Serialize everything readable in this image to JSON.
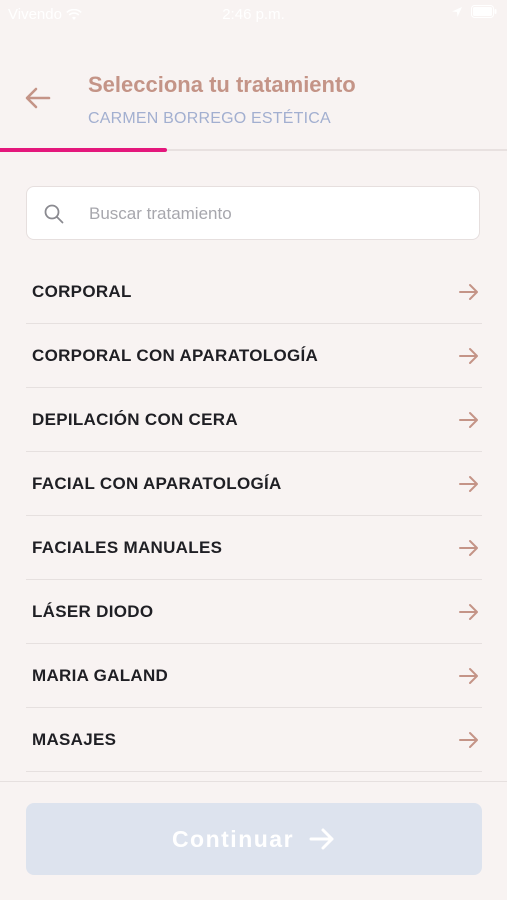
{
  "status_bar": {
    "carrier": "Vivendo",
    "time": "2:46 p.m."
  },
  "header": {
    "back_icon": "arrow-left-icon",
    "title": "Selecciona tu tratamiento",
    "subtitle": "CARMEN BORREGO ESTÉTICA"
  },
  "progress": {
    "value_percent": 33,
    "color": "#e4177c"
  },
  "search": {
    "icon": "search-icon",
    "placeholder": "Buscar tratamiento",
    "value": ""
  },
  "treatments": [
    {
      "label": "CORPORAL"
    },
    {
      "label": "CORPORAL CON APARATOLOGÍA"
    },
    {
      "label": "DEPILACIÓN CON CERA"
    },
    {
      "label": "FACIAL CON APARATOLOGÍA"
    },
    {
      "label": "FACIALES MANUALES"
    },
    {
      "label": "LÁSER DIODO"
    },
    {
      "label": "MARIA GALAND"
    },
    {
      "label": "MASAJES"
    }
  ],
  "continue_button": {
    "label": "Continuar",
    "icon": "arrow-right-icon",
    "enabled": false
  },
  "colors": {
    "accent": "#c49487",
    "subtitle": "#a2afd0",
    "background": "#f8f3f2",
    "button_disabled": "#dde3ee"
  }
}
